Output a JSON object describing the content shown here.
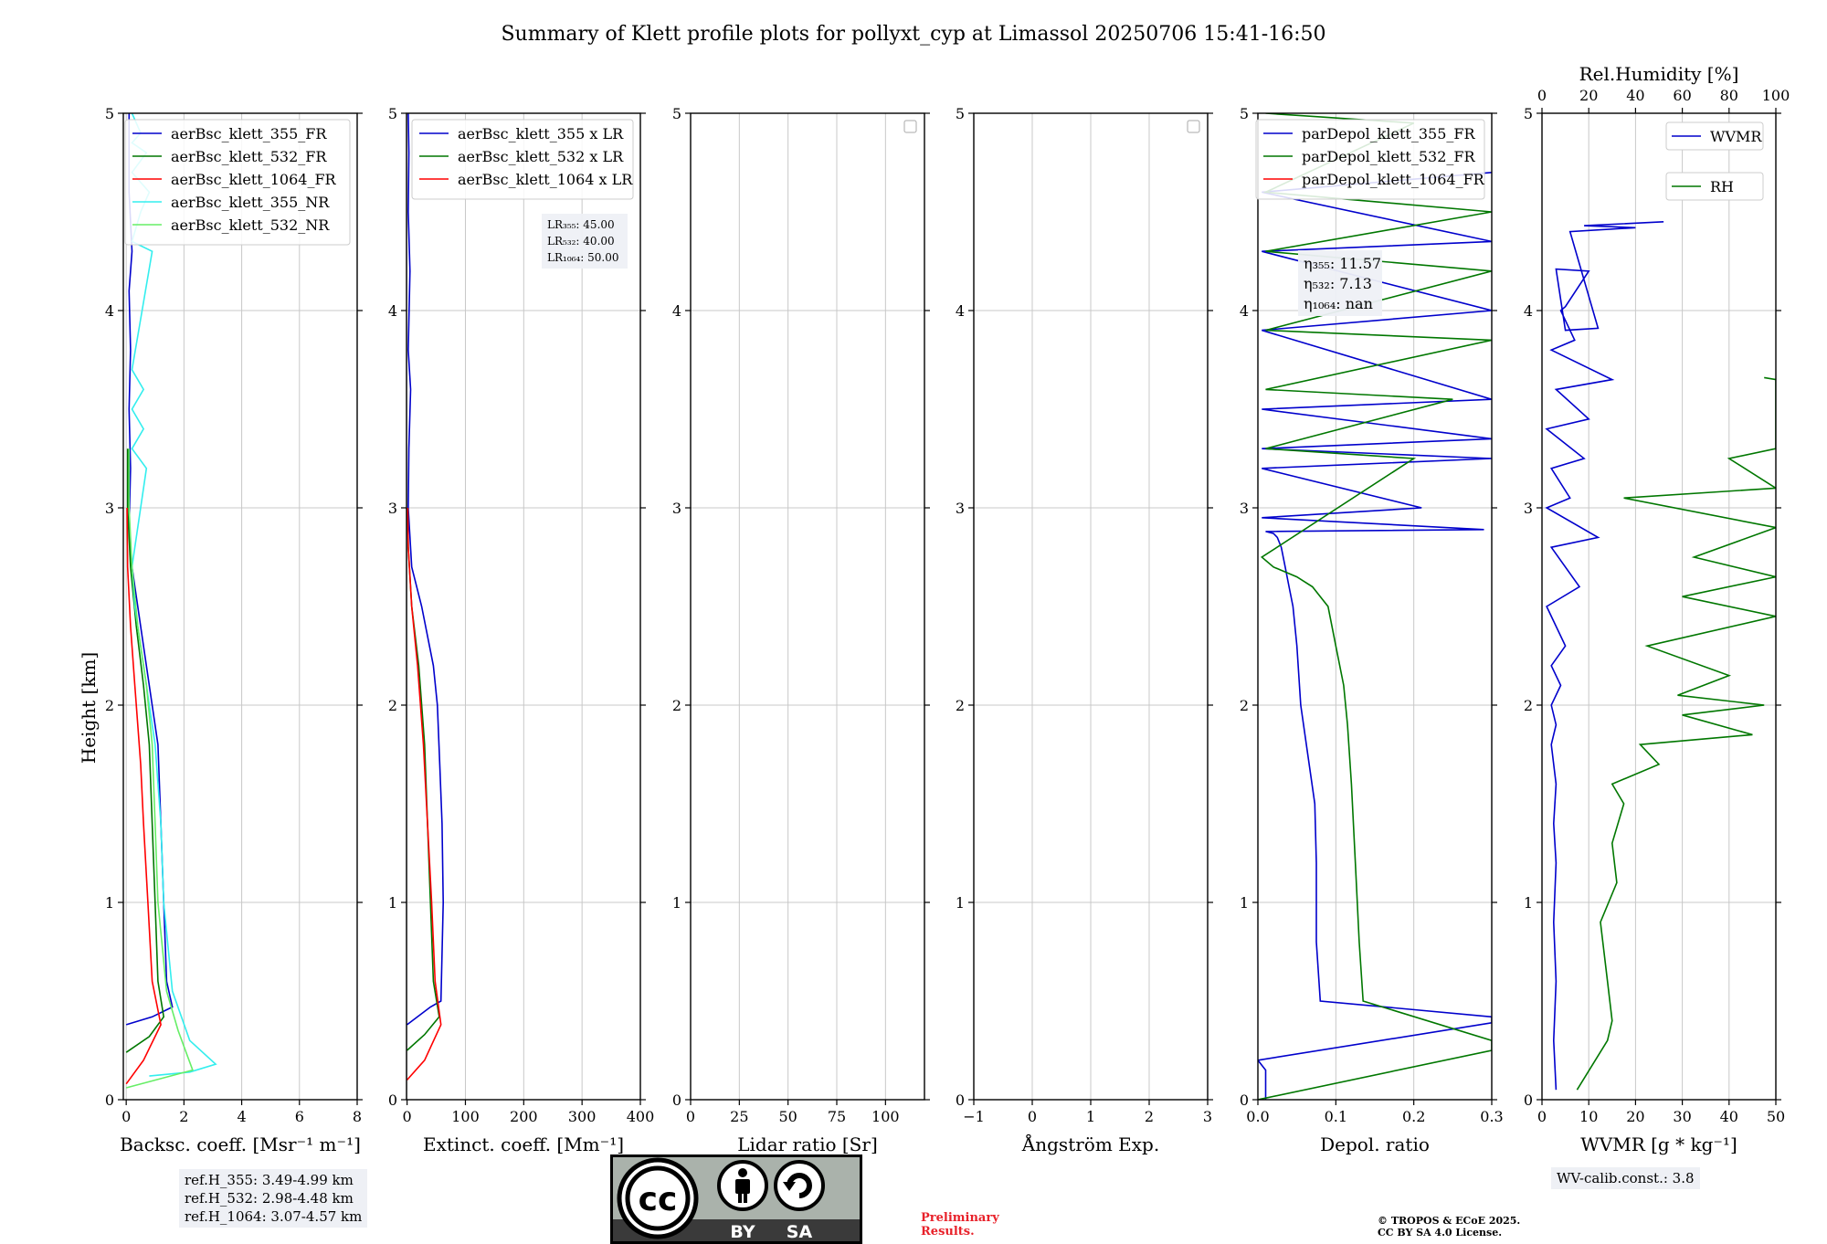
{
  "figure": {
    "title": "Summary of Klett profile plots for pollyxt_cyp at Limassol 20250706 15:41-16:50",
    "ylabel": "Height [km]"
  },
  "chart_data": [
    {
      "type": "line",
      "panel": "backscatter",
      "xlabel": "Backsc. coeff. [Msr⁻¹ m⁻¹]",
      "xlim": [
        -0.1,
        8
      ],
      "xticks": [
        0,
        2,
        4,
        6,
        8
      ],
      "ylim": [
        0,
        5
      ],
      "yticks": [
        0,
        1,
        2,
        3,
        4,
        5
      ],
      "grid": true,
      "legend_position": "top-right",
      "series": [
        {
          "name": "aerBsc_klett_355_FR",
          "color": "#0000cc",
          "x": [
            0.0,
            0.9,
            1.6,
            1.4,
            1.3,
            1.2,
            1.1,
            0.8,
            0.6,
            0.4,
            0.2,
            0.1,
            0.15,
            0.1,
            0.15,
            0.1,
            0.2,
            0.1,
            0.1
          ],
          "y": [
            0.38,
            0.42,
            0.47,
            0.6,
            1.0,
            1.4,
            1.8,
            2.1,
            2.3,
            2.5,
            2.7,
            2.9,
            3.2,
            3.5,
            3.8,
            4.1,
            4.3,
            4.6,
            5.0
          ]
        },
        {
          "name": "aerBsc_klett_532_FR",
          "color": "#007700",
          "x": [
            0.0,
            0.8,
            1.3,
            1.1,
            1.0,
            0.9,
            0.8,
            0.6,
            0.35,
            0.15,
            0.05,
            0.05
          ],
          "y": [
            0.24,
            0.32,
            0.42,
            0.6,
            1.0,
            1.4,
            1.8,
            2.1,
            2.4,
            2.7,
            3.0,
            3.3
          ]
        },
        {
          "name": "aerBsc_klett_1064_FR",
          "color": "#ff0000",
          "x": [
            0.0,
            0.6,
            1.2,
            0.9,
            0.75,
            0.6,
            0.5,
            0.3,
            0.15,
            0.05,
            0.03
          ],
          "y": [
            0.08,
            0.2,
            0.38,
            0.6,
            1.0,
            1.4,
            1.7,
            2.1,
            2.4,
            2.7,
            3.0
          ]
        },
        {
          "name": "aerBsc_klett_355_NR",
          "color": "#33eeee",
          "x": [
            0.8,
            2.2,
            3.1,
            2.2,
            1.6,
            1.3,
            1.2,
            1.0,
            0.6,
            0.3,
            0.2,
            0.3,
            0.7,
            0.2,
            0.6,
            0.2,
            0.6,
            0.2,
            0.9,
            0.2,
            0.5,
            0.8,
            0.2,
            0.7,
            0.2,
            0.5,
            0.2
          ],
          "y": [
            0.12,
            0.14,
            0.18,
            0.3,
            0.55,
            1.0,
            1.4,
            1.8,
            2.2,
            2.5,
            2.7,
            2.8,
            3.2,
            3.3,
            3.4,
            3.5,
            3.6,
            3.7,
            4.3,
            4.35,
            4.5,
            4.6,
            4.7,
            4.8,
            4.85,
            4.9,
            5.0
          ]
        },
        {
          "name": "aerBsc_klett_532_NR",
          "color": "#66ee66",
          "x": [
            0.0,
            2.3,
            1.8,
            1.4,
            1.1,
            1.0,
            0.9,
            0.7,
            0.4,
            0.2,
            0.1,
            0.1
          ],
          "y": [
            0.06,
            0.15,
            0.35,
            0.55,
            1.0,
            1.4,
            1.8,
            2.1,
            2.4,
            2.7,
            3.0,
            3.3
          ]
        }
      ]
    },
    {
      "type": "line",
      "panel": "extinction",
      "xlabel": "Extinct. coeff. [Mm⁻¹]",
      "xlim": [
        -1,
        400
      ],
      "xticks": [
        0,
        100,
        200,
        300,
        400
      ],
      "ylim": [
        0,
        5
      ],
      "yticks": [
        0,
        1,
        2,
        3,
        4,
        5
      ],
      "grid": true,
      "legend_position": "top-right",
      "annotation": [
        {
          "label": "LR₃₅₅: 45.00"
        },
        {
          "label": "LR₅₃₂: 40.00"
        },
        {
          "label": "LR₁₀₆₄: 50.00"
        }
      ],
      "series": [
        {
          "name": "aerBsc_klett_355 x LR",
          "color": "#0000cc",
          "x": [
            0,
            40,
            58,
            62,
            60,
            56,
            52,
            45,
            25,
            8,
            2,
            3,
            6,
            2,
            5,
            2,
            3,
            2
          ],
          "y": [
            0.38,
            0.47,
            0.5,
            1.0,
            1.4,
            1.7,
            2.0,
            2.2,
            2.5,
            2.7,
            3.0,
            3.3,
            3.6,
            3.8,
            4.2,
            4.5,
            4.8,
            5.0
          ]
        },
        {
          "name": "aerBsc_klett_532 x LR",
          "color": "#007700",
          "x": [
            0,
            30,
            55,
            45,
            40,
            35,
            30,
            20,
            8,
            2,
            1
          ],
          "y": [
            0.25,
            0.33,
            0.42,
            0.6,
            1.0,
            1.4,
            1.8,
            2.2,
            2.5,
            2.8,
            3.0
          ]
        },
        {
          "name": "aerBsc_klett_1064 x LR",
          "color": "#ff0000",
          "x": [
            0,
            30,
            58,
            48,
            42,
            35,
            28,
            18,
            8,
            2,
            1
          ],
          "y": [
            0.1,
            0.2,
            0.38,
            0.6,
            1.0,
            1.4,
            1.8,
            2.2,
            2.5,
            2.8,
            3.0
          ]
        }
      ]
    },
    {
      "type": "line",
      "panel": "lidar-ratio",
      "xlabel": "Lidar ratio [Sr]",
      "xlim": [
        0,
        120
      ],
      "xticks": [
        0,
        25,
        50,
        75,
        100
      ],
      "ylim": [
        0,
        5
      ],
      "yticks": [
        0,
        1,
        2,
        3,
        4,
        5
      ],
      "grid": true,
      "legend_position": "top-right",
      "series": []
    },
    {
      "type": "line",
      "panel": "angstrom",
      "xlabel": "Ångström Exp.",
      "xlim": [
        -1,
        3
      ],
      "xticks": [
        -1,
        0,
        1,
        2,
        3
      ],
      "ylim": [
        0,
        5
      ],
      "yticks": [
        0,
        1,
        2,
        3,
        4,
        5
      ],
      "grid": true,
      "legend_position": "top-right",
      "series": []
    },
    {
      "type": "line",
      "panel": "depolarization",
      "xlabel": "Depol. ratio",
      "xlim": [
        0,
        0.3
      ],
      "xticks": [
        0.0,
        0.1,
        0.2,
        0.3
      ],
      "xticklabels": [
        "0.0",
        "0.1",
        "0.2",
        "0.3"
      ],
      "ylim": [
        0,
        5
      ],
      "yticks": [
        0,
        1,
        2,
        3,
        4,
        5
      ],
      "grid": true,
      "legend_position": "top-right",
      "annotation": [
        {
          "label": "η₃₅₅: 11.57"
        },
        {
          "label": "η₅₃₂: 7.13"
        },
        {
          "label": "η₁₀₆₄: nan"
        }
      ],
      "series": [
        {
          "name": "parDepol_klett_355_FR",
          "color": "#0000cc",
          "x": [
            0.01,
            0.01,
            0.0,
            0.3,
            0.3,
            0.08,
            0.075,
            0.075,
            0.073,
            0.055,
            0.05,
            0.045,
            0.04,
            0.035,
            0.03,
            0.025,
            0.02,
            0.01,
            0.29,
            0.005,
            0.21,
            0.005,
            0.3,
            0.005,
            0.3,
            0.005,
            0.3,
            0.005,
            0.3,
            0.005,
            0.3,
            0.005,
            0.3
          ],
          "y": [
            0.0,
            0.15,
            0.2,
            0.39,
            0.42,
            0.5,
            0.8,
            1.2,
            1.5,
            2.0,
            2.3,
            2.5,
            2.6,
            2.7,
            2.8,
            2.85,
            2.87,
            2.88,
            2.89,
            2.95,
            3.0,
            3.2,
            3.25,
            3.3,
            3.35,
            3.5,
            3.55,
            3.9,
            4.0,
            4.3,
            4.35,
            4.6,
            4.7
          ]
        },
        {
          "name": "parDepol_klett_532_FR",
          "color": "#007700",
          "x": [
            0.0,
            0.3,
            0.3,
            0.135,
            0.13,
            0.125,
            0.12,
            0.115,
            0.11,
            0.1,
            0.09,
            0.07,
            0.05,
            0.02,
            0.005,
            0.2,
            0.01,
            0.25,
            0.01,
            0.3,
            0.01,
            0.3,
            0.01,
            0.3,
            0.01,
            0.2,
            0.01
          ],
          "y": [
            0.0,
            0.25,
            0.3,
            0.5,
            0.8,
            1.2,
            1.6,
            1.9,
            2.1,
            2.3,
            2.5,
            2.6,
            2.65,
            2.7,
            2.75,
            3.25,
            3.3,
            3.55,
            3.6,
            3.85,
            3.9,
            4.2,
            4.3,
            4.5,
            4.6,
            4.95,
            5.0
          ]
        },
        {
          "name": "parDepol_klett_1064_FR",
          "color": "#ff0000",
          "x": [],
          "y": []
        }
      ]
    },
    {
      "type": "line",
      "panel": "water-vapor",
      "xlabel": "WVMR [g * kg⁻¹]",
      "xlim": [
        0,
        50
      ],
      "xticks": [
        0,
        10,
        20,
        30,
        40,
        50
      ],
      "x2label": "Rel.Humidity [%]",
      "x2lim": [
        0,
        100
      ],
      "x2ticks": [
        0,
        20,
        40,
        60,
        80,
        100
      ],
      "ylim": [
        0,
        5
      ],
      "yticks": [
        0,
        1,
        2,
        3,
        4,
        5
      ],
      "grid": true,
      "legend_position": "top-right",
      "series": [
        {
          "name": "WVMR",
          "color": "#0000cc",
          "x": [
            3,
            2.5,
            3,
            2.5,
            3,
            2.5,
            3,
            2,
            3,
            2,
            4,
            2,
            5,
            1,
            8,
            2,
            12,
            1,
            6,
            2,
            9,
            1,
            10,
            3,
            15,
            2,
            7,
            4,
            5,
            10,
            3,
            5,
            12,
            6,
            20,
            9,
            26
          ],
          "y": [
            0.05,
            0.3,
            0.6,
            0.9,
            1.2,
            1.4,
            1.6,
            1.8,
            1.9,
            2.0,
            2.1,
            2.2,
            2.3,
            2.5,
            2.6,
            2.8,
            2.85,
            3.0,
            3.05,
            3.2,
            3.25,
            3.4,
            3.45,
            3.6,
            3.65,
            3.8,
            3.85,
            4.0,
            4.02,
            4.2,
            4.21,
            3.9,
            3.91,
            4.4,
            4.42,
            4.43,
            4.45
          ]
        },
        {
          "name": "RH",
          "color": "#007700",
          "x": [
            15,
            28,
            30,
            28,
            25,
            32,
            30,
            35,
            30,
            50,
            42,
            90,
            60,
            95,
            58,
            80,
            45,
            100,
            60,
            100,
            65,
            100,
            35,
            100,
            80,
            100,
            100,
            100,
            95
          ],
          "y": [
            0.05,
            0.3,
            0.4,
            0.6,
            0.9,
            1.1,
            1.3,
            1.5,
            1.6,
            1.7,
            1.8,
            1.85,
            1.95,
            2.0,
            2.05,
            2.15,
            2.3,
            2.45,
            2.55,
            2.65,
            2.75,
            2.9,
            3.05,
            3.1,
            3.25,
            3.3,
            3.4,
            3.65,
            3.66
          ]
        }
      ]
    }
  ],
  "footer": {
    "ref_heights": [
      "ref.H_355: 3.49-4.99 km",
      "ref.H_532: 2.98-4.48 km",
      "ref.H_1064: 3.07-4.57 km"
    ],
    "wv_calib": "WV-calib.const.: 3.8",
    "preliminary": [
      "Preliminary",
      "Results."
    ],
    "copyright": [
      "© TROPOS & ECoE 2025.",
      "CC BY SA 4.0 License."
    ],
    "license_badge": {
      "cc": "cc",
      "by": "BY",
      "sa": "SA"
    }
  }
}
